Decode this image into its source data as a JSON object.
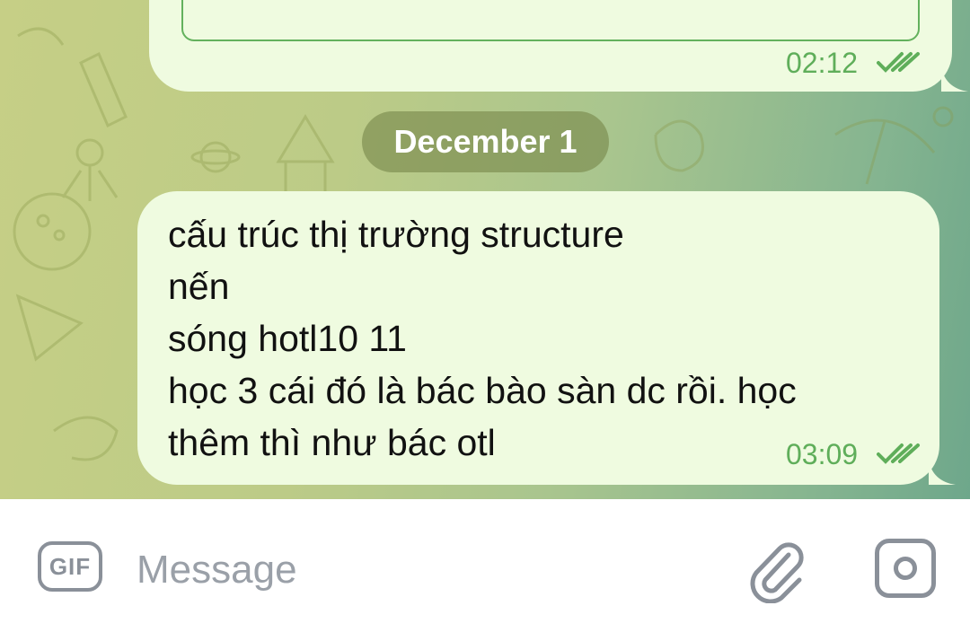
{
  "chat": {
    "previous_message": {
      "time": "02:12",
      "status_icon": "double-check-icon"
    },
    "date_separator": "December 1",
    "message": {
      "lines": [
        "cấu trúc thị trường structure",
        "nến",
        "sóng hotl10 11",
        "học 3 cái đó là bác bào sàn dc rồi. học",
        "thêm thì như bác otl"
      ],
      "time": "03:09",
      "status_icon": "double-check-icon"
    }
  },
  "composer": {
    "gif_label": "GIF",
    "placeholder": "Message",
    "attach_icon": "paperclip-icon",
    "camera_icon": "camera-icon"
  },
  "colors": {
    "bubble": "#effbe0",
    "accent_green": "#5fae5a",
    "icon_gray": "#8a9099"
  }
}
